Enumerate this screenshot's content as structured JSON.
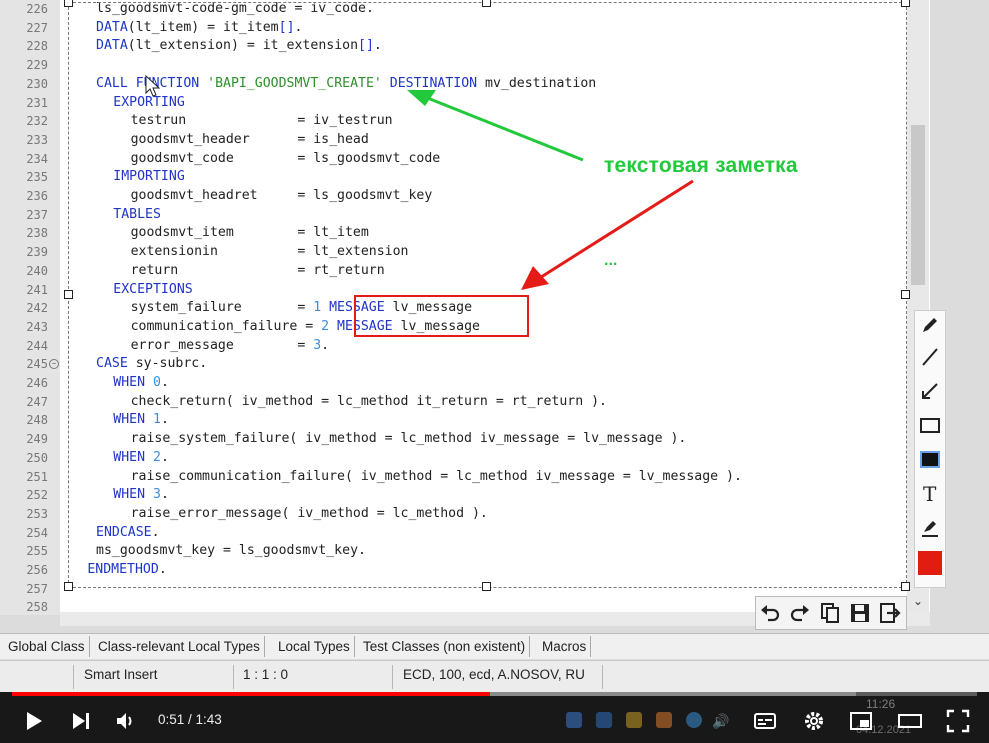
{
  "editor": {
    "lines": [
      {
        "n": "226",
        "seg": [
          [
            "t",
            "ls_goodsmvt-code-gm_code = iv_code."
          ]
        ],
        "indent": 0
      },
      {
        "n": "227",
        "seg": [
          [
            "k",
            "DATA"
          ],
          [
            "t",
            "(lt_item) = it_item"
          ],
          [
            "k",
            "[]"
          ],
          [
            "t",
            "."
          ]
        ],
        "indent": 0
      },
      {
        "n": "228",
        "seg": [
          [
            "k",
            "DATA"
          ],
          [
            "t",
            "(lt_extension) = it_extension"
          ],
          [
            "k",
            "[]"
          ],
          [
            "t",
            "."
          ]
        ],
        "indent": 0
      },
      {
        "n": "229",
        "seg": [],
        "indent": 0
      },
      {
        "n": "230",
        "seg": [
          [
            "k",
            "CALL FUNCTION "
          ],
          [
            "s",
            "'BAPI_GOODSMVT_CREATE'"
          ],
          [
            "k",
            " DESTINATION"
          ],
          [
            "t",
            " mv_destination"
          ]
        ],
        "indent": 0
      },
      {
        "n": "231",
        "seg": [
          [
            "k",
            "EXPORTING"
          ]
        ],
        "indent": 2
      },
      {
        "n": "232",
        "seg": [
          [
            "t",
            "testrun              = iv_testrun"
          ]
        ],
        "indent": 4
      },
      {
        "n": "233",
        "seg": [
          [
            "t",
            "goodsmvt_header      = is_head"
          ]
        ],
        "indent": 4
      },
      {
        "n": "234",
        "seg": [
          [
            "t",
            "goodsmvt_code        = ls_goodsmvt_code"
          ]
        ],
        "indent": 4
      },
      {
        "n": "235",
        "seg": [
          [
            "k",
            "IMPORTING"
          ]
        ],
        "indent": 2
      },
      {
        "n": "236",
        "seg": [
          [
            "t",
            "goodsmvt_headret     = ls_goodsmvt_key"
          ]
        ],
        "indent": 4
      },
      {
        "n": "237",
        "seg": [
          [
            "k",
            "TABLES"
          ]
        ],
        "indent": 2
      },
      {
        "n": "238",
        "seg": [
          [
            "t",
            "goodsmvt_item        = lt_item"
          ]
        ],
        "indent": 4
      },
      {
        "n": "239",
        "seg": [
          [
            "t",
            "extensionin          = lt_extension"
          ]
        ],
        "indent": 4
      },
      {
        "n": "240",
        "seg": [
          [
            "t",
            "return               = rt_return"
          ]
        ],
        "indent": 4
      },
      {
        "n": "241",
        "seg": [
          [
            "k",
            "EXCEPTIONS"
          ]
        ],
        "indent": 2
      },
      {
        "n": "242",
        "seg": [
          [
            "t",
            "system_failure       = "
          ],
          [
            "n",
            "1"
          ],
          [
            "k",
            " MESSAGE"
          ],
          [
            "t",
            " lv_message"
          ]
        ],
        "indent": 4
      },
      {
        "n": "243",
        "seg": [
          [
            "t",
            "communication_failure = "
          ],
          [
            "n",
            "2"
          ],
          [
            "k",
            " MESSAGE"
          ],
          [
            "t",
            " lv_message"
          ]
        ],
        "indent": 4
      },
      {
        "n": "244",
        "seg": [
          [
            "t",
            "error_message        = "
          ],
          [
            "n",
            "3"
          ],
          [
            "t",
            "."
          ]
        ],
        "indent": 4
      },
      {
        "n": "245",
        "seg": [
          [
            "k",
            "CASE"
          ],
          [
            "t",
            " sy-subrc."
          ]
        ],
        "indent": 0,
        "fold": true
      },
      {
        "n": "246",
        "seg": [
          [
            "k",
            "WHEN "
          ],
          [
            "n",
            "0"
          ],
          [
            "t",
            "."
          ]
        ],
        "indent": 2
      },
      {
        "n": "247",
        "seg": [
          [
            "t",
            "check_return( iv_method = lc_method it_return = rt_return )."
          ]
        ],
        "indent": 4
      },
      {
        "n": "248",
        "seg": [
          [
            "k",
            "WHEN "
          ],
          [
            "n",
            "1"
          ],
          [
            "t",
            "."
          ]
        ],
        "indent": 2
      },
      {
        "n": "249",
        "seg": [
          [
            "t",
            "raise_system_failure( iv_method = lc_method iv_message = lv_message )."
          ]
        ],
        "indent": 4
      },
      {
        "n": "250",
        "seg": [
          [
            "k",
            "WHEN "
          ],
          [
            "n",
            "2"
          ],
          [
            "t",
            "."
          ]
        ],
        "indent": 2
      },
      {
        "n": "251",
        "seg": [
          [
            "t",
            "raise_communication_failure( iv_method = lc_method iv_message = lv_message )."
          ]
        ],
        "indent": 4
      },
      {
        "n": "252",
        "seg": [
          [
            "k",
            "WHEN "
          ],
          [
            "n",
            "3"
          ],
          [
            "t",
            "."
          ]
        ],
        "indent": 2
      },
      {
        "n": "253",
        "seg": [
          [
            "t",
            "raise_error_message( iv_method = lc_method )."
          ]
        ],
        "indent": 4
      },
      {
        "n": "254",
        "seg": [
          [
            "k",
            "ENDCASE"
          ],
          [
            "t",
            "."
          ]
        ],
        "indent": 0
      },
      {
        "n": "255",
        "seg": [
          [
            "t",
            "ms_goodsmvt_key = ls_goodsmvt_key."
          ]
        ],
        "indent": 0
      },
      {
        "n": "256",
        "seg": [
          [
            "k",
            "ENDMETHOD"
          ],
          [
            "t",
            "."
          ]
        ],
        "indent": -1
      },
      {
        "n": "257",
        "seg": [],
        "indent": 0
      },
      {
        "n": "258",
        "seg": [],
        "indent": 0
      }
    ]
  },
  "annotation": {
    "note_text": "текстовая заметка",
    "dots": "...",
    "arrow_color": "#22c93a",
    "box_color": "#e41b17"
  },
  "draw_toolbar": {
    "tools": [
      "pencil-icon",
      "line-icon",
      "arrow-icon",
      "rectangle-icon",
      "filled-rectangle-icon",
      "text-icon",
      "marker-icon"
    ],
    "selected_color": "#e11d12",
    "actions": [
      "undo-icon",
      "redo-icon",
      "copy-icon",
      "save-icon",
      "export-icon"
    ]
  },
  "tabs": [
    "Global Class",
    "Class-relevant Local Types",
    "Local Types",
    "Test Classes (non existent)",
    "Macros"
  ],
  "status": {
    "mode": "Smart Insert",
    "position": "1 : 1 : 0",
    "system": "ECD, 100, ecd, A.NOSOV, RU"
  },
  "player": {
    "current": "0:51",
    "duration": "1:43",
    "time_text": "0:51 / 1:43",
    "progress": 0.4952,
    "buffered": 0.875,
    "clock": "11:26",
    "date": "04.12.2021"
  }
}
